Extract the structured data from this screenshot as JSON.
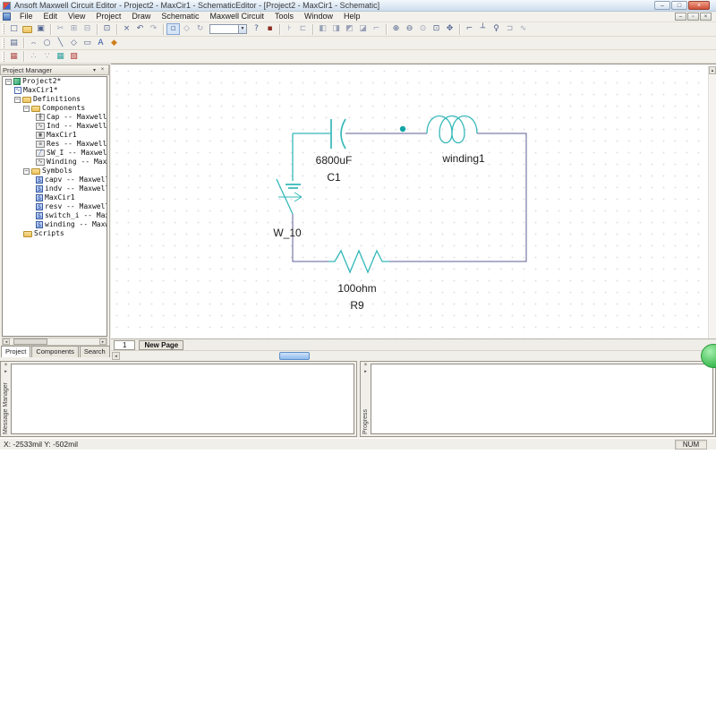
{
  "window": {
    "title": "Ansoft Maxwell Circuit Editor  - Project2 - MaxCir1 - SchematicEditor - [Project2 - MaxCir1 - Schematic]",
    "minimize": "–",
    "maximize": "□",
    "close": "×",
    "mdi_minimize": "–",
    "mdi_restore": "▫",
    "mdi_close": "×"
  },
  "menu": {
    "items": [
      "File",
      "Edit",
      "View",
      "Project",
      "Draw",
      "Schematic",
      "Maxwell Circuit",
      "Tools",
      "Window",
      "Help"
    ]
  },
  "toolbar": {
    "glyphs": {
      "new_file": "□",
      "save": "▣",
      "cut": "✂",
      "copy": "⊞",
      "paste": "⊟",
      "print": "⊡",
      "delete": "×",
      "undo": "↶",
      "redo": "↷",
      "select": "▫",
      "move": "◇",
      "rotate": "↻",
      "combo_arrow": "▼",
      "help_pointer": "?",
      "stop": "▪",
      "snap": "⊦",
      "properties": "⊏",
      "mirror_h": "◧",
      "mirror_v": "◨",
      "flip": "◩",
      "align": "◪",
      "swap": "⌐",
      "zoom_in": "⊕",
      "zoom_out": "⊖",
      "zoom_fit": "⊙",
      "zoom_area": "⊡",
      "pan": "✥",
      "wire": "⌐",
      "ground": "┴",
      "probe": "♀",
      "bus": "⊐",
      "curve": "∿",
      "sheet": "▤",
      "arc": "⌢",
      "circle": "○",
      "line": "╲",
      "polygon": "◇",
      "rectangle": "▭",
      "text": "A",
      "color": "◆",
      "ruler": "▦",
      "grid_a": "∴",
      "grid_b": "∵",
      "table": "▦",
      "annotate": "▧"
    }
  },
  "project_manager": {
    "title": "Project Manager",
    "header_pin": "▾",
    "header_close": "×",
    "minus": "−",
    "icons": {
      "cap": "╫",
      "ind": "∿",
      "box": "▣",
      "res": "≡",
      "sw": "╱",
      "winding": "∿",
      "sym": "S",
      "wave": "∿"
    },
    "tree": [
      "Project2*",
      "MaxCir1*",
      "Definitions",
      "Components",
      "Cap -- Maxwell C",
      "Ind -- Maxwell C",
      "MaxCir1",
      "Res -- Maxwell C",
      "SW_I -- Maxwell",
      "Winding -- Maxwe",
      "Symbols",
      "capv -- Maxwell",
      "indv -- Maxwell",
      "MaxCir1",
      "resv -- Maxwell",
      "switch_i -- Maxw",
      "winding -- Maxwe",
      "Scripts"
    ],
    "tabs": [
      "Project",
      "Components",
      "Search"
    ],
    "scroll_left": "◂",
    "scroll_right": "▸",
    "scroll_up": "▴",
    "scroll_down": "▾"
  },
  "schematic": {
    "page_tab": "1",
    "new_page_label": "New Page",
    "labels": {
      "cap_value": "6800uF",
      "cap_name": "C1",
      "winding_name": "winding1",
      "switch_name": "W_10",
      "res_value": "100ohm",
      "res_name": "R9"
    },
    "colors": {
      "teal": "#35b8b8",
      "navy": "#5c5c94",
      "dot": "#12a5a5"
    }
  },
  "panels": {
    "message_manager": {
      "title": "Message Manager",
      "close": "×",
      "pin": "▸"
    },
    "progress": {
      "title": "Progress",
      "close": "×",
      "pin": "▸"
    }
  },
  "status": {
    "coordinates": "X: -2533mil   Y: -502mil",
    "num": "NUM"
  }
}
